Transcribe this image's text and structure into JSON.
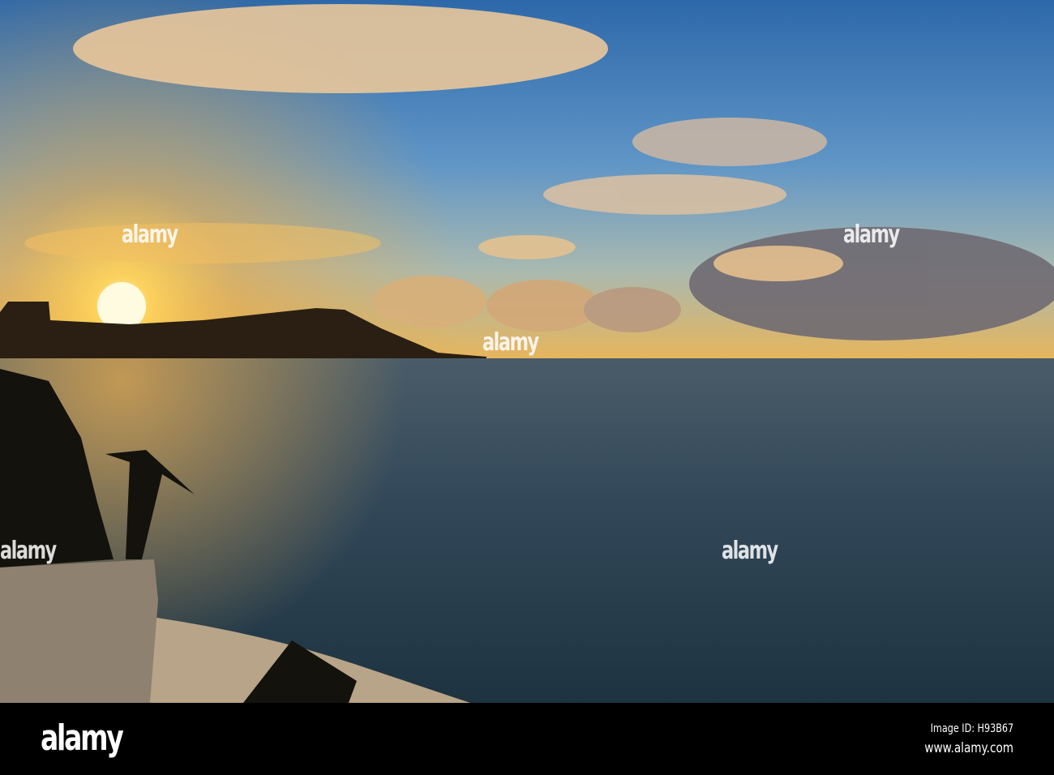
{
  "photo": {
    "subject": "sunrise-over-waikiki-diamond-head",
    "colors": {
      "sky_top": "#2f6fb0",
      "sky_mid": "#6a9cc8",
      "horizon": "#f4b640",
      "sun": "#fff6c0",
      "sea": "#2c4250",
      "sea_near": "#1f3340"
    }
  },
  "watermark": {
    "text": "alamy"
  },
  "footer": {
    "logo": "alamy",
    "image_id": "Image ID: H93B67",
    "website": "www.alamy.com"
  }
}
